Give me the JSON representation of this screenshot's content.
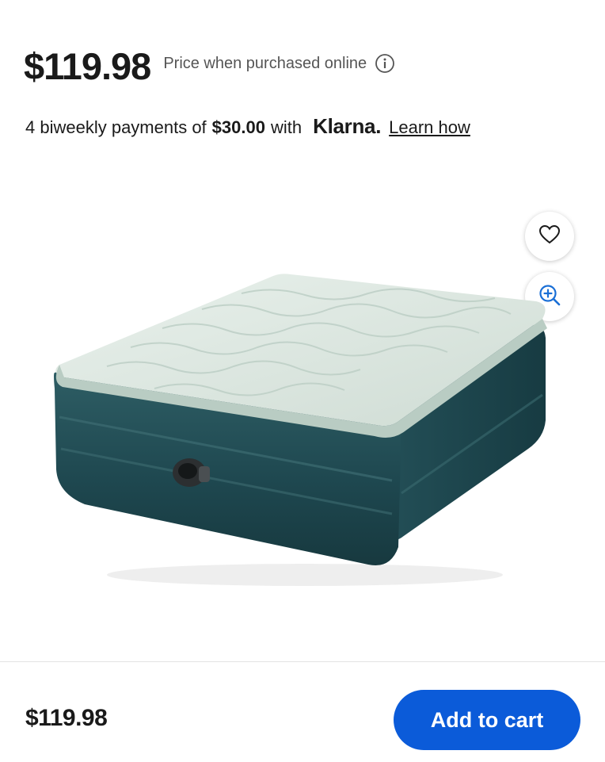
{
  "price": {
    "main": "$119.98",
    "note": "Price when purchased online"
  },
  "klarna": {
    "prefix": "4 biweekly payments of",
    "amount": "$30.00",
    "with": "with",
    "brand": "Klarna.",
    "link": "Learn how"
  },
  "icons": {
    "info": "info-icon",
    "favorite": "heart-icon",
    "zoom": "zoom-in-icon"
  },
  "product_image": {
    "subject": "air-mattress"
  },
  "bottom_bar": {
    "price": "$119.98",
    "add_to_cart": "Add to cart"
  },
  "colors": {
    "accent": "#0b5bd9",
    "zoom_icon": "#1a6fd6"
  }
}
